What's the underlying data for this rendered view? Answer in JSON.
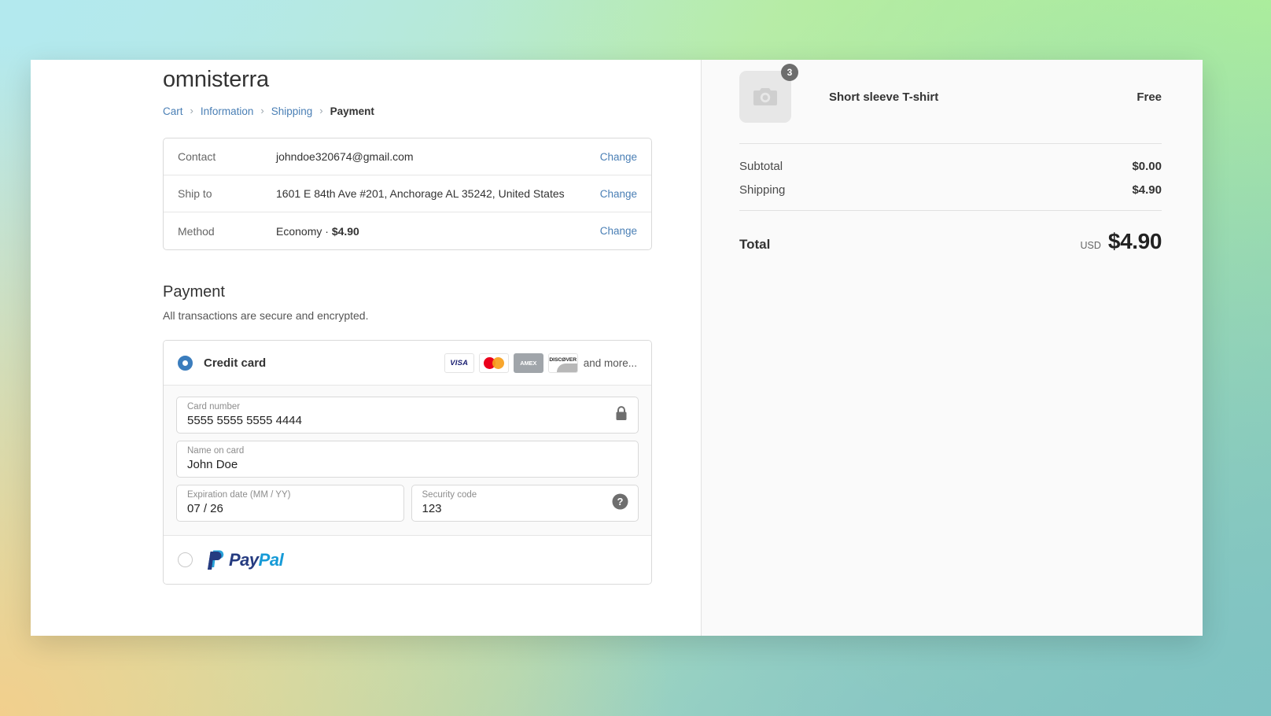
{
  "shop": {
    "name": "omnisterra"
  },
  "breadcrumb": {
    "items": [
      {
        "label": "Cart",
        "current": false
      },
      {
        "label": "Information",
        "current": false
      },
      {
        "label": "Shipping",
        "current": false
      },
      {
        "label": "Payment",
        "current": true
      }
    ],
    "separator": "›"
  },
  "review": {
    "rows": [
      {
        "label": "Contact",
        "value": "johndoe320674@gmail.com",
        "action": "Change"
      },
      {
        "label": "Ship to",
        "value": "1601 E 84th Ave #201, Anchorage AL 35242, United States",
        "action": "Change"
      },
      {
        "label": "Method",
        "value": "Economy · ",
        "value_bold": "$4.90",
        "action": "Change"
      }
    ]
  },
  "payment": {
    "title": "Payment",
    "subtitle": "All transactions are secure and encrypted.",
    "methods": {
      "credit_card": {
        "label": "Credit card",
        "selected": true,
        "brands": [
          "VISA",
          "mastercard",
          "AMEX",
          "DISCOVER"
        ],
        "brand_visa_text": "VISA",
        "brand_amex_text": "AMEX",
        "brand_discover_text": "DISCØVER",
        "more_text": "and more..."
      },
      "paypal": {
        "label": "PayPal",
        "selected": false,
        "logo_pay": "Pay",
        "logo_pal": "Pal"
      }
    },
    "fields": {
      "card_number": {
        "label": "Card number",
        "value": "5555 5555 5555 4444",
        "placeholder": "Card number",
        "icon": "lock-icon"
      },
      "name_on_card": {
        "label": "Name on card",
        "value": "John Doe",
        "placeholder": "Name on card"
      },
      "expiration": {
        "label": "Expiration date (MM / YY)",
        "value": "07 / 26",
        "placeholder": "Expiration date (MM / YY)"
      },
      "security_code": {
        "label": "Security code",
        "value": "123",
        "placeholder": "Security code",
        "icon": "help-icon"
      }
    }
  },
  "summary": {
    "items": [
      {
        "name": "Short sleeve T-shirt",
        "quantity": "3",
        "price": "Free"
      }
    ],
    "totals": [
      {
        "label": "Subtotal",
        "value": "$0.00"
      },
      {
        "label": "Shipping",
        "value": "$4.90"
      }
    ],
    "grand_total": {
      "label": "Total",
      "currency": "USD",
      "amount": "$4.90"
    }
  },
  "colors": {
    "link": "#4a7fb5",
    "radio_selected": "#3b7dbd",
    "panel_bg": "#fafafa",
    "badge_bg": "#6d6d6d"
  }
}
